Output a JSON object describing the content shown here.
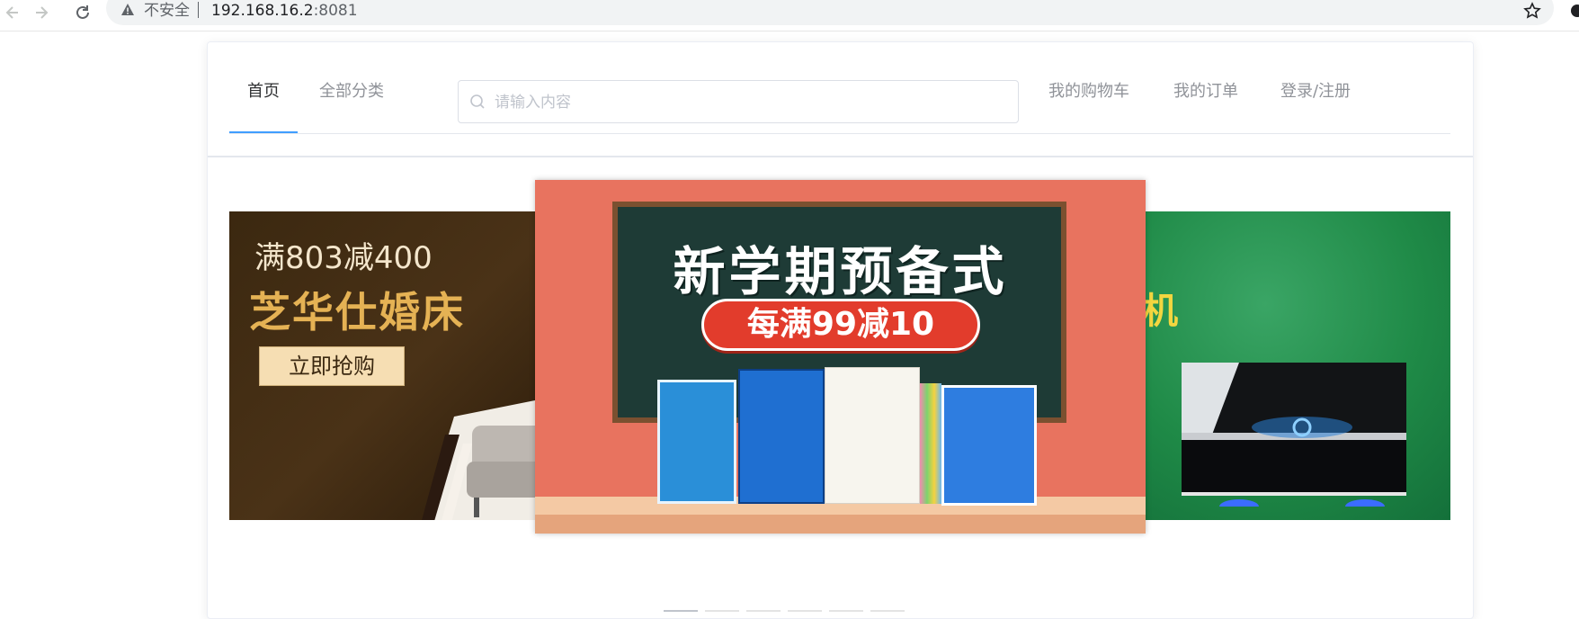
{
  "browser": {
    "security_label": "不安全",
    "url_host": "192.168.16.2",
    "url_port": ":8081"
  },
  "nav": {
    "home": "首页",
    "categories": "全部分类",
    "cart": "我的购物车",
    "orders": "我的订单",
    "login": "登录/注册",
    "active_tab": "首页"
  },
  "search": {
    "placeholder": "请输入内容"
  },
  "carousel": {
    "left_slide": {
      "line1": "满803减400",
      "line2": "芝华仕婚床",
      "button": "立即抢购"
    },
    "center_slide": {
      "title": "新学期预备式",
      "promo": "每满99减10"
    },
    "right_slide": {
      "partial_text": "机"
    },
    "indicator_count": 6,
    "active_index": 0
  },
  "colors": {
    "accent": "#409eff",
    "nav_text": "#909399",
    "nav_active_text": "#303133"
  }
}
